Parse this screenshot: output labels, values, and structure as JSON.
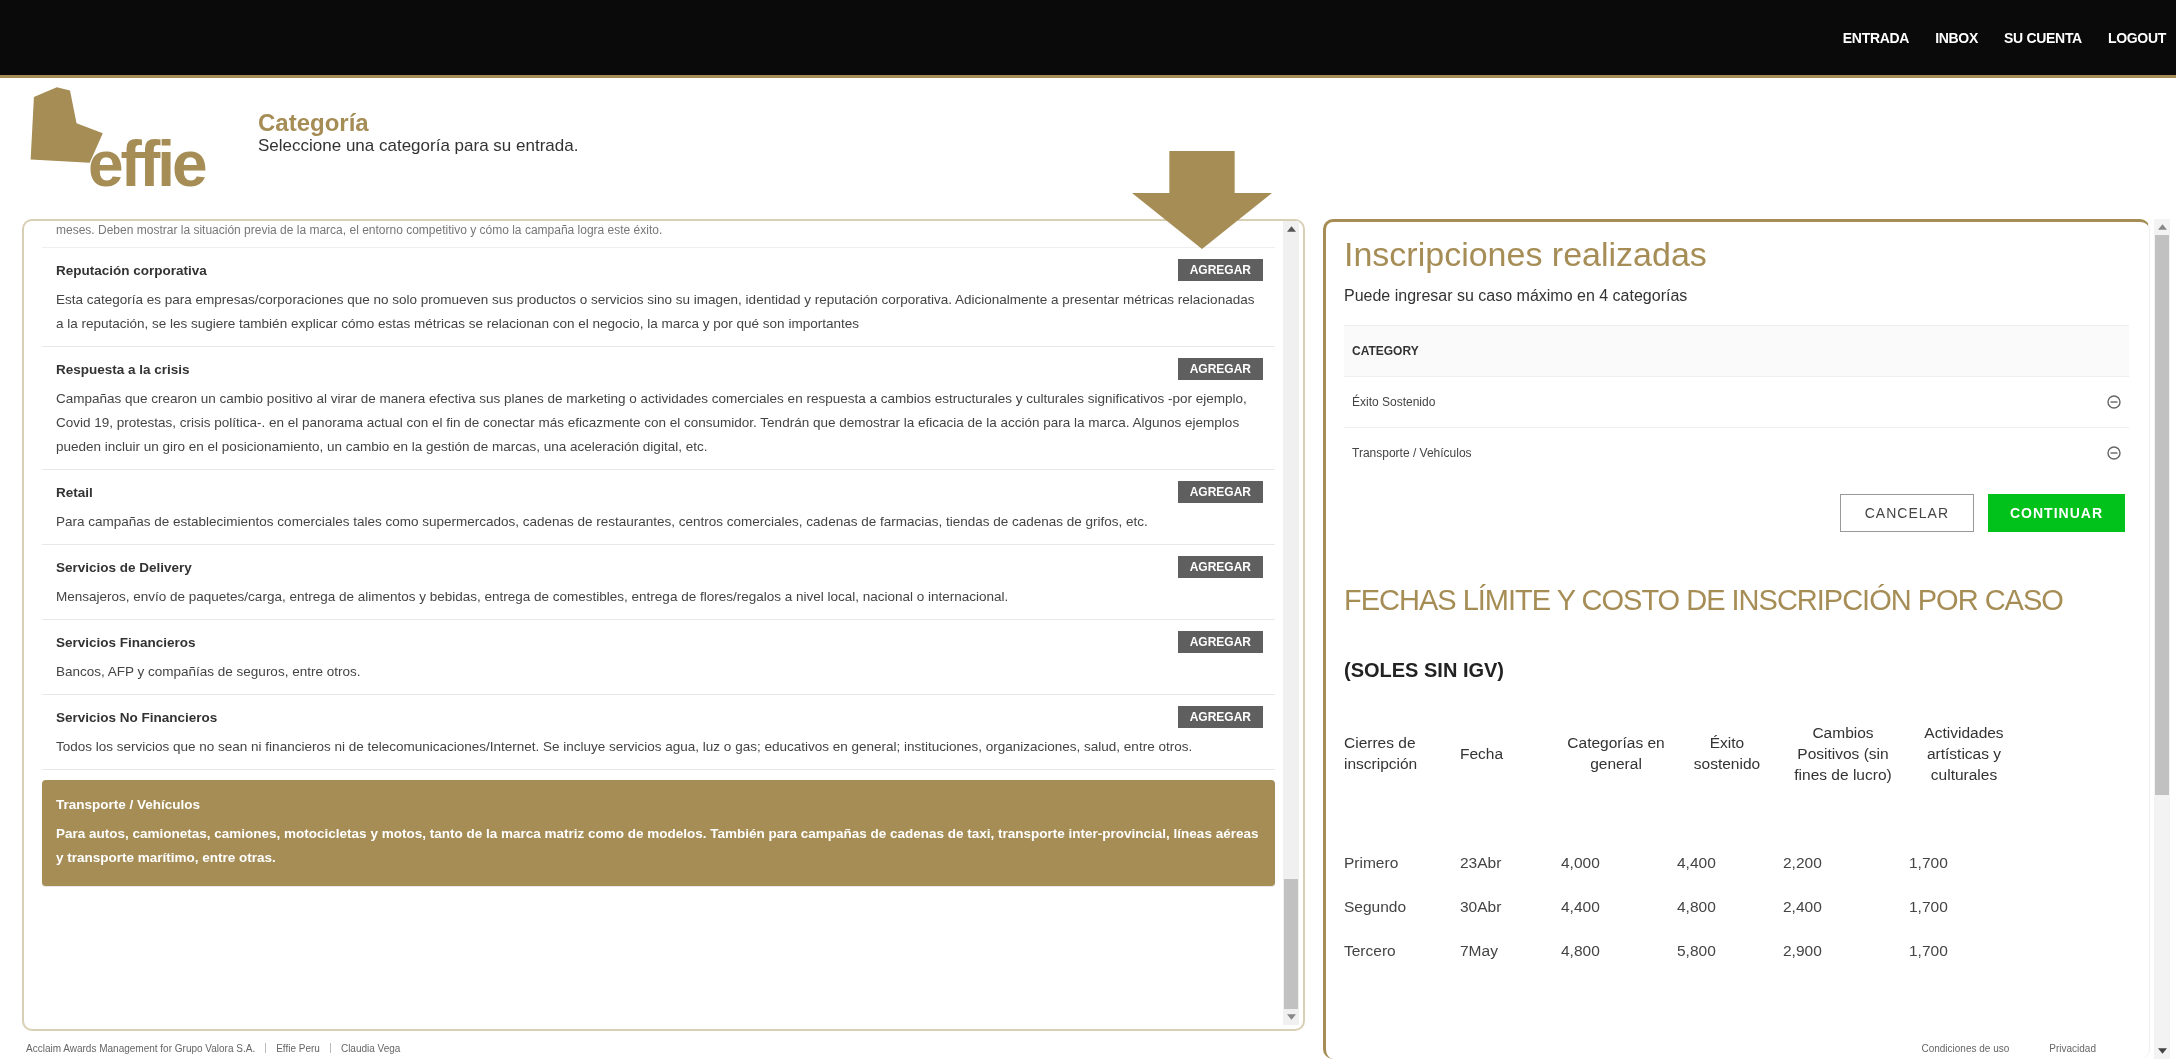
{
  "nav": [
    "ENTRADA",
    "INBOX",
    "SU CUENTA",
    "LOGOUT"
  ],
  "logo": {
    "text": "effie"
  },
  "header": {
    "title": "Categoría",
    "subtitle": "Seleccione una categoría para su entrada."
  },
  "categories_cut_text": "meses. Deben mostrar la situación previa de la marca, el entorno competitivo y cómo la campaña logra este éxito.",
  "categories": [
    {
      "title": "Reputación corporativa",
      "description": "Esta categoría es para empresas/corporaciones que no solo promueven sus productos o servicios sino su imagen, identidad y reputación corporativa. Adicionalmente a presentar métricas relacionadas a la reputación, se les sugiere también explicar cómo estas métricas se relacionan con el negocio, la marca y por qué son importantes",
      "button": "AGREGAR",
      "selected": false
    },
    {
      "title": "Respuesta a la crisis",
      "description": "Campañas que crearon un cambio positivo al virar de manera efectiva sus planes de marketing o actividades comerciales en respuesta a cambios estructurales y culturales significativos -por ejemplo, Covid 19, protestas, crisis política-. en el panorama actual con el fin de conectar más eficazmente con el consumidor. Tendrán que demostrar la eficacia de la acción para la marca. Algunos ejemplos pueden incluir un giro en el posicionamiento, un cambio en la gestión de marcas, una aceleración digital, etc.",
      "button": "AGREGAR",
      "selected": false
    },
    {
      "title": "Retail",
      "description": "Para campañas de establecimientos comerciales tales como supermercados, cadenas de restaurantes, centros comerciales, cadenas de farmacias, tiendas de cadenas de grifos, etc.",
      "button": "AGREGAR",
      "selected": false
    },
    {
      "title": "Servicios de Delivery",
      "description": "Mensajeros, envío de paquetes/carga, entrega de alimentos y bebidas, entrega de comestibles, entrega de flores/regalos a nivel local, nacional o internacional.",
      "button": "AGREGAR",
      "selected": false
    },
    {
      "title": "Servicios Financieros",
      "description": "Bancos, AFP y compañías de seguros, entre otros.",
      "button": "AGREGAR",
      "selected": false
    },
    {
      "title": "Servicios No Financieros",
      "description": "Todos los servicios que no sean ni financieros ni de telecomunicaciones/Internet. Se incluye servicios agua, luz o gas; educativos en general; instituciones, organizaciones, salud, entre otros.",
      "button": "AGREGAR",
      "selected": false
    },
    {
      "title": "Transporte / Vehículos",
      "description": "Para autos, camionetas, camiones, motocicletas y motos, tanto de la marca matriz como de modelos. También para campañas de cadenas de taxi, transporte inter-provincial, líneas aéreas y transporte marítimo, entre otras.",
      "selected": true
    }
  ],
  "inscriptions": {
    "title": "Inscripciones realizadas",
    "subtitle": "Puede ingresar su caso máximo en 4 categorías",
    "column": "CATEGORY",
    "rows": [
      "Éxito Sostenido",
      "Transporte / Vehículos"
    ],
    "buttons": [
      {
        "label": "CANCELAR",
        "kind": "secondary"
      },
      {
        "label": "CONTINUAR",
        "kind": "primary"
      }
    ]
  },
  "fees": {
    "title": "FECHAS LÍMITE Y COSTO DE INSCRIPCIÓN POR CASO",
    "subtitle": "(SOLES SIN IGV)",
    "columns": [
      "Cierres de inscripción",
      "Fecha",
      "Categorías en general",
      "Éxito sostenido",
      "Cambios Positivos (sin fines de lucro)",
      "Actividades artísticas y culturales"
    ],
    "rows": [
      [
        "Primero",
        "23Abr",
        "4,000",
        "4,400",
        "2,200",
        "1,700"
      ],
      [
        "Segundo",
        "30Abr",
        "4,400",
        "4,800",
        "2,400",
        "1,700"
      ],
      [
        "Tercero",
        "7May",
        "4,800",
        "5,800",
        "2,900",
        "1,700"
      ]
    ]
  },
  "footer": {
    "left": [
      "Acclaim Awards Management for Grupo Valora S.A.",
      "Effie Peru",
      "Claudia Vega"
    ],
    "right": [
      "Condiciones de uso",
      "Privacidad"
    ]
  }
}
